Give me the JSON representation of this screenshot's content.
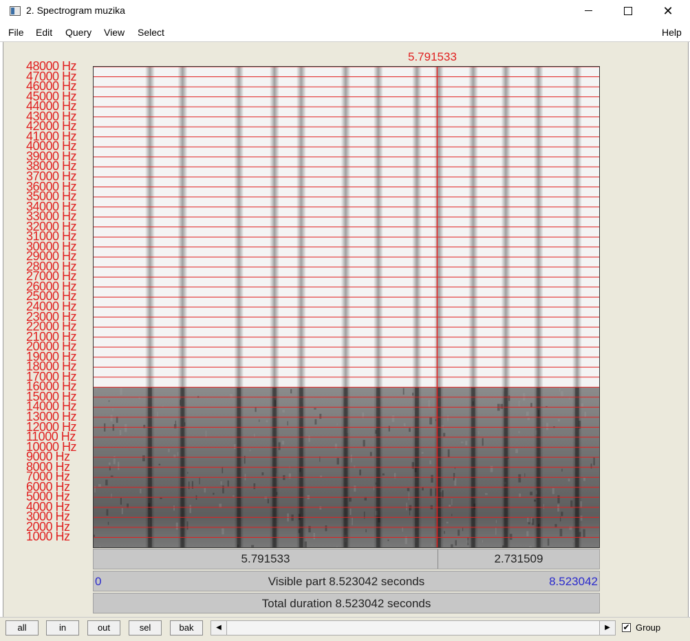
{
  "window": {
    "title": "2. Spectrogram muzika",
    "minimize_icon": "minimize-icon",
    "maximize_icon": "maximize-icon",
    "close_icon": "close-icon",
    "close_glyph": "✕"
  },
  "menu": {
    "items": [
      "File",
      "Edit",
      "Query",
      "View",
      "Select"
    ],
    "help": "Help"
  },
  "cursor": {
    "time": "5.791533"
  },
  "frequency_axis": {
    "labels": [
      "48000 Hz",
      "47000 Hz",
      "46000 Hz",
      "45000 Hz",
      "44000 Hz",
      "43000 Hz",
      "42000 Hz",
      "41000 Hz",
      "40000 Hz",
      "39000 Hz",
      "38000 Hz",
      "37000 Hz",
      "36000 Hz",
      "35000 Hz",
      "34000 Hz",
      "33000 Hz",
      "32000 Hz",
      "31000 Hz",
      "30000 Hz",
      "29000 Hz",
      "28000 Hz",
      "27000 Hz",
      "26000 Hz",
      "25000 Hz",
      "24000 Hz",
      "23000 Hz",
      "22000 Hz",
      "21000 Hz",
      "20000 Hz",
      "19000 Hz",
      "18000 Hz",
      "17000 Hz",
      "16000 Hz",
      "15000 Hz",
      "14000 Hz",
      "13000 Hz",
      "12000 Hz",
      "11000 Hz",
      "10000 Hz",
      "9000 Hz",
      "8000 Hz",
      "7000 Hz",
      "6000 Hz",
      "5000 Hz",
      "4000 Hz",
      "3000 Hz",
      "2000 Hz",
      "1000 Hz"
    ],
    "max_hz": 48000,
    "color": "#e02020"
  },
  "spectrogram": {
    "visible_start": 0,
    "visible_end": 8.523042,
    "cursor_time": 5.791533,
    "dense_region_top_hz": 16000,
    "onset_times": [
      0.95,
      1.5,
      2.45,
      3.05,
      3.5,
      4.25,
      4.8,
      5.45,
      5.82,
      6.4,
      6.95,
      7.5,
      8.15
    ]
  },
  "time_bars": {
    "selection_left": "5.791533",
    "selection_right": "2.731509",
    "visible_start": "0",
    "visible_text": "Visible part 8.523042 seconds",
    "visible_end": "8.523042",
    "total_text": "Total duration 8.523042 seconds"
  },
  "bottom": {
    "buttons": [
      "all",
      "in",
      "out",
      "sel",
      "bak"
    ],
    "scroll_left_glyph": "◀",
    "scroll_right_glyph": "▶",
    "group_checked": true,
    "group_check_glyph": "✔",
    "group_label": "Group"
  }
}
